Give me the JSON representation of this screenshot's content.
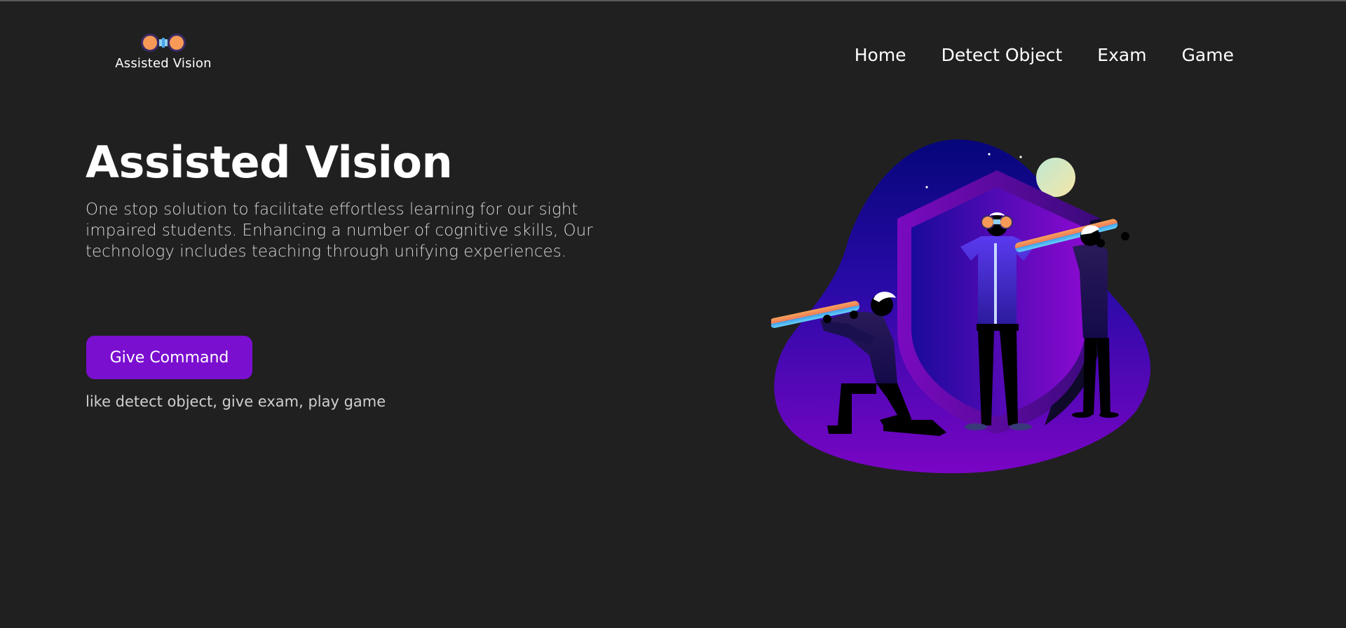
{
  "brand": {
    "name": "Assisted Vision",
    "logo_icon": "binoculars-icon"
  },
  "nav": {
    "items": [
      {
        "label": "Home"
      },
      {
        "label": "Detect Object"
      },
      {
        "label": "Exam"
      },
      {
        "label": "Game"
      }
    ]
  },
  "hero": {
    "title": "Assisted Vision",
    "description": "One stop solution to facilitate effortless learning for our sight impaired students. Enhancing a number of cognitive skills, Our technology includes teaching through unifying experiences.",
    "button_label": "Give Command",
    "hint": "like detect object, give exam, play game"
  },
  "colors": {
    "background": "#202020",
    "accent": "#7b0fd0",
    "text": "#ffffff"
  }
}
